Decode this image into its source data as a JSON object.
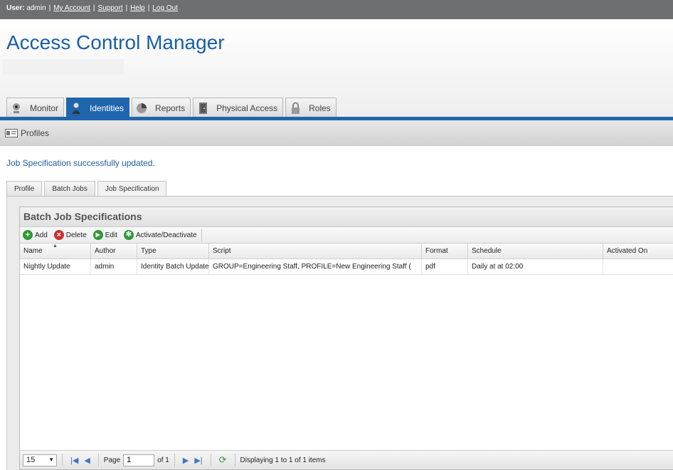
{
  "userbar": {
    "user_label": "User:",
    "username": "admin",
    "links": [
      "My Account",
      "Support",
      "Help",
      "Log Out"
    ]
  },
  "header": {
    "title": "Access Control Manager"
  },
  "main_tabs": [
    {
      "label": "Monitor",
      "icon": "webcam-icon",
      "active": false
    },
    {
      "label": "Identities",
      "icon": "person-icon",
      "active": true
    },
    {
      "label": "Reports",
      "icon": "pie-chart-icon",
      "active": false
    },
    {
      "label": "Physical Access",
      "icon": "door-icon",
      "active": false
    },
    {
      "label": "Roles",
      "icon": "lock-icon",
      "active": false
    }
  ],
  "subbar": {
    "label": "Profiles",
    "icon": "id-card-icon"
  },
  "message": "Job Specification successfully updated.",
  "sub_tabs": [
    {
      "label": "Profile",
      "active": false
    },
    {
      "label": "Batch Jobs",
      "active": false
    },
    {
      "label": "Job Specification",
      "active": true
    }
  ],
  "panel": {
    "title": "Batch Job Specifications",
    "toolbar": [
      {
        "label": "Add",
        "icon": "plus-icon"
      },
      {
        "label": "Delete",
        "icon": "x-icon"
      },
      {
        "label": "Edit",
        "icon": "play-icon"
      },
      {
        "label": "Activate/Deactivate",
        "icon": "gear-icon"
      }
    ],
    "columns": [
      "Name",
      "Author",
      "Type",
      "Script",
      "Format",
      "Schedule",
      "Activated On"
    ],
    "rows": [
      [
        "Nightly Update",
        "admin",
        "Identity Batch Update",
        "GROUP=Engineering Staff, PROFILE=New Engineering Staff (",
        "pdf",
        "Daily at at 02:00",
        ""
      ]
    ]
  },
  "pager": {
    "page_size": "15",
    "page_label": "Page",
    "page_value": "1",
    "of_label": "of 1",
    "display_text": "Displaying 1 to 1 of 1 items"
  }
}
